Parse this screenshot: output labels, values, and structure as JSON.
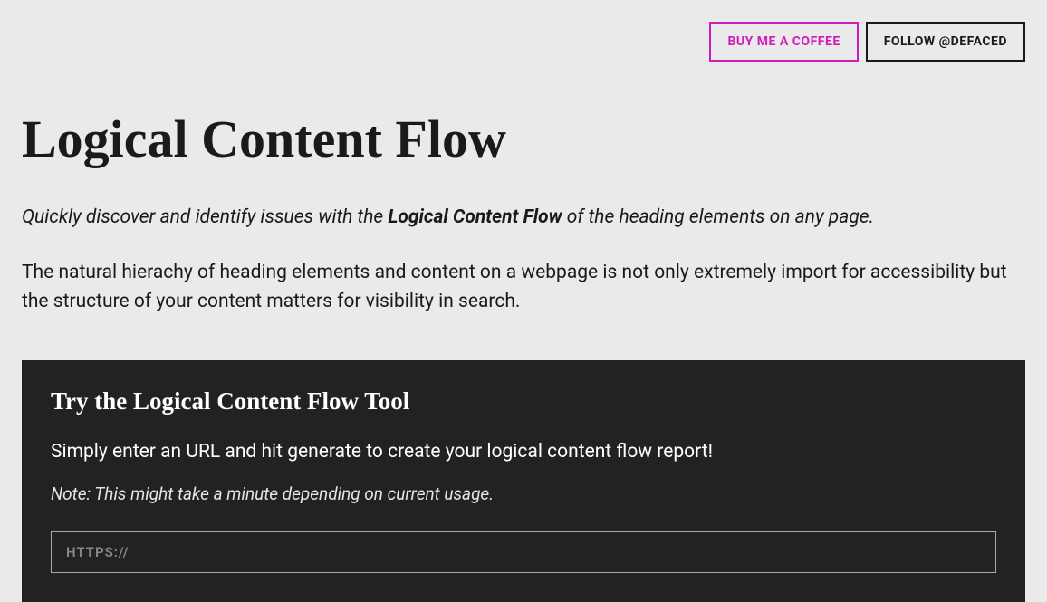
{
  "header": {
    "coffee_label": "BUY ME A COFFEE",
    "follow_label": "FOLLOW @DEFACED"
  },
  "main": {
    "title": "Logical Content Flow",
    "intro_prefix": "Quickly discover and identify issues with the ",
    "intro_bold": "Logical Content Flow",
    "intro_suffix": " of the heading elements on any page.",
    "body": "The natural hierachy of heading elements and content on a webpage is not only extremely import for accessibility but the structure of your content matters for visibility in search."
  },
  "tool": {
    "heading": "Try the Logical Content Flow Tool",
    "description": "Simply enter an URL and hit generate to create your logical content flow report!",
    "note": "Note: This might take a minute depending on current usage.",
    "url_placeholder": "HTTPS://",
    "url_value": ""
  }
}
